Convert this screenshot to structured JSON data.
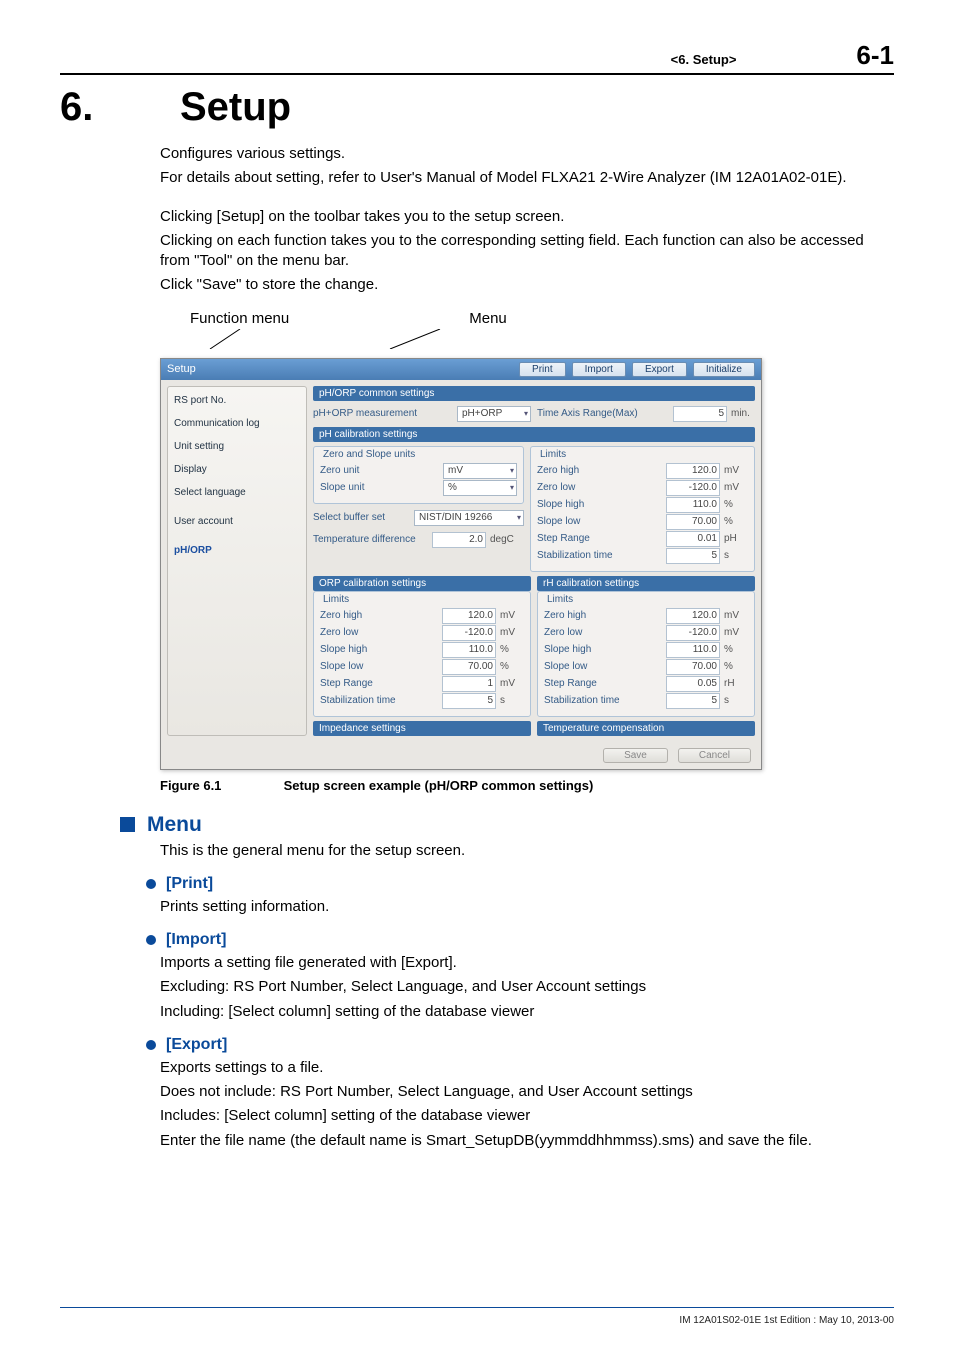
{
  "header": {
    "section": "<6. Setup>",
    "page": "6-1"
  },
  "chapter": {
    "number": "6.",
    "title": "Setup"
  },
  "intro": {
    "p1": "Configures various settings.",
    "p2": "For details about setting, refer to User's Manual of Model FLXA21 2-Wire Analyzer (IM 12A01A02-01E).",
    "p3": "Clicking [Setup] on the toolbar takes you to the setup screen.",
    "p4": "Clicking on each function takes you to the corresponding setting field. Each function can also be accessed from \"Tool\" on the menu bar.",
    "p5": "Click \"Save\" to store the change."
  },
  "labels": {
    "function_menu": "Function menu",
    "menu": "Menu"
  },
  "screenshot": {
    "title": "Setup",
    "toolbar": {
      "print": "Print",
      "import": "Import",
      "export": "Export",
      "initialize": "Initialize"
    },
    "sidemenu": {
      "items": [
        "RS port No.",
        "Communication log",
        "Unit setting",
        "Display",
        "Select language",
        "User account",
        "pH/ORP"
      ],
      "selected": "pH/ORP"
    },
    "sections": {
      "common_hdr": "pH/ORP common settings",
      "common": {
        "measurement_label": "pH+ORP measurement",
        "measurement_value": "pH+ORP",
        "time_axis_label": "Time Axis Range(Max)",
        "time_axis_value": "5",
        "time_axis_unit": "min."
      },
      "ph_cal_hdr": "pH calibration settings",
      "zero_slope": {
        "legend": "Zero and Slope units",
        "zero_unit_label": "Zero unit",
        "zero_unit_value": "mV",
        "slope_unit_label": "Slope unit",
        "slope_unit_value": "%"
      },
      "buffer": {
        "label": "Select buffer set",
        "value": "NIST/DIN 19266"
      },
      "temp_diff": {
        "label": "Temperature difference",
        "value": "2.0",
        "unit": "degC"
      },
      "limits_ph": {
        "legend": "Limits",
        "zero_high": {
          "label": "Zero high",
          "value": "120.0",
          "unit": "mV"
        },
        "zero_low": {
          "label": "Zero low",
          "value": "-120.0",
          "unit": "mV"
        },
        "slope_high": {
          "label": "Slope high",
          "value": "110.0",
          "unit": "%"
        },
        "slope_low": {
          "label": "Slope low",
          "value": "70.00",
          "unit": "%"
        },
        "step_range": {
          "label": "Step Range",
          "value": "0.01",
          "unit": "pH"
        },
        "stab_time": {
          "label": "Stabilization time",
          "value": "5",
          "unit": "s"
        }
      },
      "orp_cal_hdr": "ORP calibration settings",
      "orp_limits": {
        "legend": "Limits",
        "zero_high": {
          "label": "Zero high",
          "value": "120.0",
          "unit": "mV"
        },
        "zero_low": {
          "label": "Zero low",
          "value": "-120.0",
          "unit": "mV"
        },
        "slope_high": {
          "label": "Slope high",
          "value": "110.0",
          "unit": "%"
        },
        "slope_low": {
          "label": "Slope low",
          "value": "70.00",
          "unit": "%"
        },
        "step_range": {
          "label": "Step Range",
          "value": "1",
          "unit": "mV"
        },
        "stab_time": {
          "label": "Stabilization time",
          "value": "5",
          "unit": "s"
        }
      },
      "rh_cal_hdr": "rH calibration settings",
      "rh_limits": {
        "legend": "Limits",
        "zero_high": {
          "label": "Zero high",
          "value": "120.0",
          "unit": "mV"
        },
        "zero_low": {
          "label": "Zero low",
          "value": "-120.0",
          "unit": "mV"
        },
        "slope_high": {
          "label": "Slope high",
          "value": "110.0",
          "unit": "%"
        },
        "slope_low": {
          "label": "Slope low",
          "value": "70.00",
          "unit": "%"
        },
        "step_range": {
          "label": "Step Range",
          "value": "0.05",
          "unit": "rH"
        },
        "stab_time": {
          "label": "Stabilization time",
          "value": "5",
          "unit": "s"
        }
      },
      "impedance_hdr": "Impedance settings",
      "temp_comp_hdr": "Temperature compensation"
    },
    "footer_buttons": {
      "save": "Save",
      "cancel": "Cancel"
    }
  },
  "figure": {
    "num": "Figure 6.1",
    "caption": "Setup screen example (pH/ORP common settings)"
  },
  "h2_menu": "Menu",
  "menu_desc": "This is the general menu for the setup screen.",
  "print": {
    "title": "[Print]",
    "p1": "Prints setting information."
  },
  "import": {
    "title": "[Import]",
    "p1": "Imports a setting file generated with [Export].",
    "p2": "Excluding: RS Port Number, Select Language, and User Account settings",
    "p3": "Including: [Select column] setting of the database viewer"
  },
  "export": {
    "title": "[Export]",
    "p1": "Exports settings to a file.",
    "p2": "Does not include: RS Port Number, Select Language, and User Account settings",
    "p3": "Includes: [Select column] setting of the database viewer",
    "p4": "Enter the file name (the default name is Smart_SetupDB(yymmddhhmmss).sms) and save the file."
  },
  "footer": {
    "text": "IM 12A01S02-01E    1st Edition : May 10, 2013-00"
  }
}
